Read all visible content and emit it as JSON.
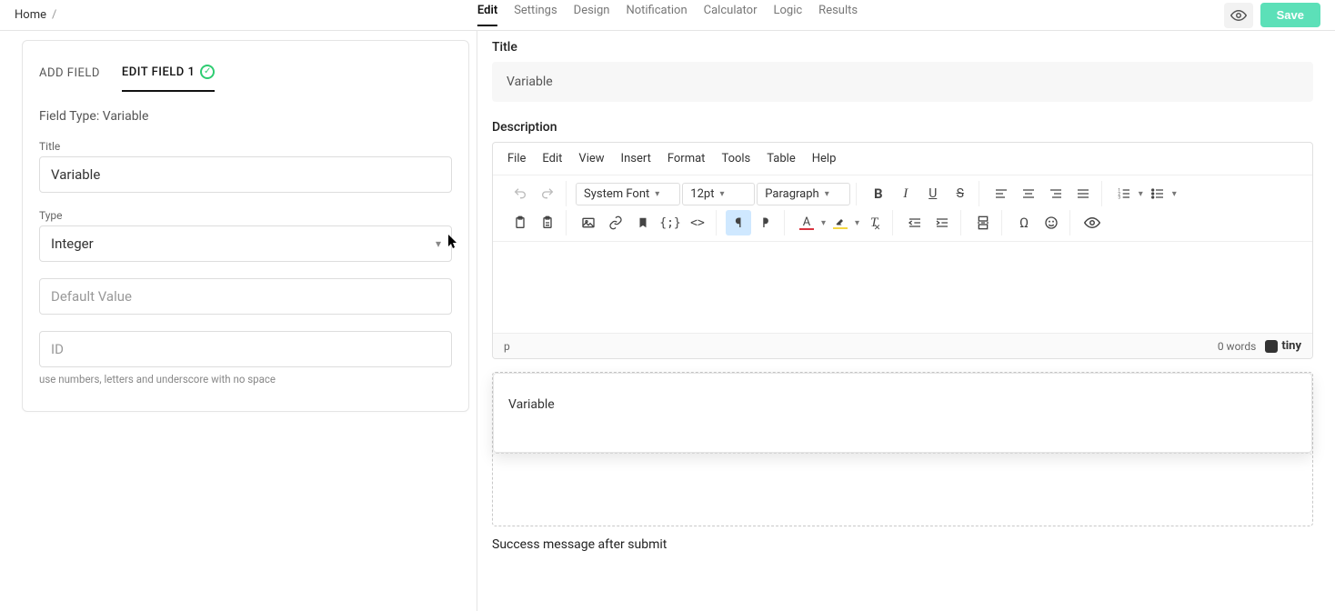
{
  "breadcrumb": {
    "home": "Home"
  },
  "nav": {
    "items": [
      "Edit",
      "Settings",
      "Design",
      "Notification",
      "Calculator",
      "Logic",
      "Results"
    ],
    "active": 0
  },
  "actions": {
    "save": "Save"
  },
  "leftPanel": {
    "tabs": {
      "add": "ADD FIELD",
      "edit": "EDIT FIELD 1"
    },
    "fieldTypeLabel": "Field Type:",
    "fieldTypeValue": "Variable",
    "title": {
      "label": "Title",
      "value": "Variable"
    },
    "type": {
      "label": "Type",
      "value": "Integer"
    },
    "defaultValue": {
      "placeholder": "Default Value",
      "value": ""
    },
    "id": {
      "placeholder": "ID",
      "value": "",
      "hint": "use numbers, letters and underscore with no space"
    }
  },
  "rightPanel": {
    "titleLabel": "Title",
    "titleValue": "Variable",
    "descriptionLabel": "Description",
    "editor": {
      "menus": [
        "File",
        "Edit",
        "View",
        "Insert",
        "Format",
        "Tools",
        "Table",
        "Help"
      ],
      "fontFamily": "System Font",
      "fontSize": "12pt",
      "blockFormat": "Paragraph",
      "statusPath": "p",
      "wordCount": "0 words",
      "brand": "tiny"
    },
    "previewFieldLabel": "Variable",
    "successLabel": "Success message after submit"
  }
}
